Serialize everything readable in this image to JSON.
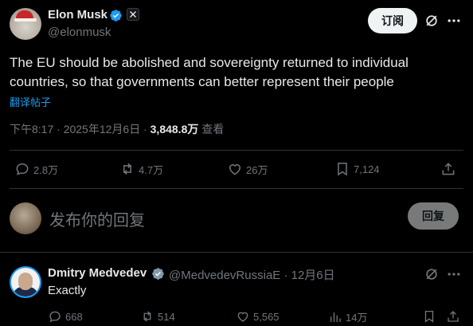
{
  "post": {
    "author_name": "Elon Musk",
    "author_handle": "@elonmusk",
    "subscribe_label": "订阅",
    "text": "The EU should be abolished and sovereignty returned to individual countries, so that governments can better represent their people",
    "translate_label": "翻译帖子",
    "time": "下午8:17 · 2025年12月6日 · ",
    "views_count": "3,848.8万",
    "views_label": " 查看",
    "stats": {
      "replies": "2.8万",
      "reposts": "4.7万",
      "likes": "26万",
      "bookmarks": "7,124"
    }
  },
  "composer": {
    "placeholder": "发布你的回复",
    "reply_button": "回复"
  },
  "reply": {
    "author_name": "Dmitry Medvedev",
    "author_handle": "@MedvedevRussiaE · 12月6日",
    "text": "Exactly",
    "stats": {
      "replies": "668",
      "reposts": "514",
      "likes": "5,565",
      "views": "14万"
    }
  },
  "colors": {
    "background": "#000000",
    "text_primary": "#e7e9ea",
    "text_secondary": "#71767b",
    "accent": "#1d9bf0",
    "divider": "#2f3336"
  },
  "icons": [
    "verified-badge-icon",
    "x-affiliation-icon",
    "grok-icon",
    "more-icon",
    "reply-icon",
    "repost-icon",
    "like-icon",
    "bookmark-icon",
    "share-icon",
    "views-icon"
  ]
}
